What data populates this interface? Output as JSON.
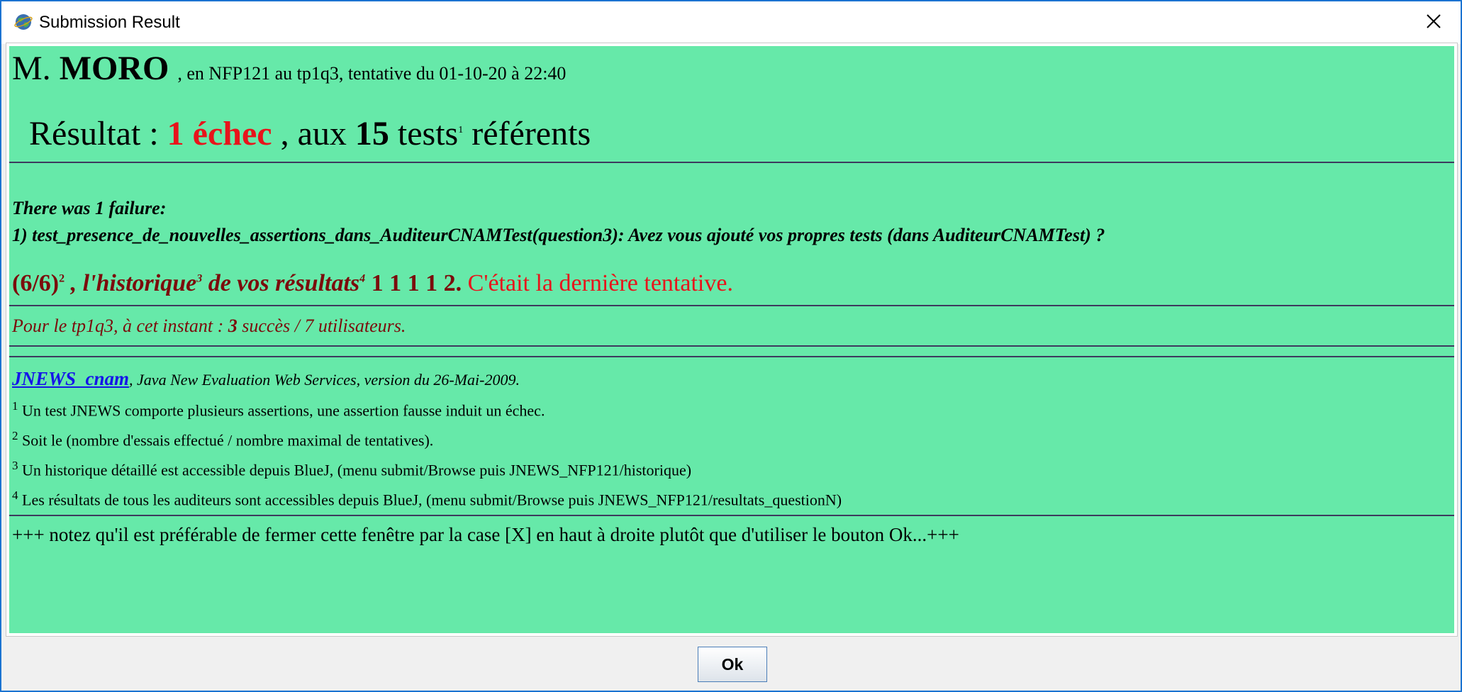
{
  "window": {
    "title": "Submission Result",
    "icon": "globe-icon",
    "close_icon": "close-icon",
    "ok_label": "Ok"
  },
  "report": {
    "honorific": "M.",
    "name": "MORO",
    "meta": ", en NFP121 au tp1q3, tentative du 01-10-20 à 22:40",
    "result_label": "Résultat :",
    "failures_count": "1 échec",
    "tests_sep": ", aux",
    "tests_count": "15",
    "tests_word": "tests",
    "tests_note_ref": "1",
    "tests_suffix": "référents",
    "failure_header": "There was 1 failure:",
    "failure_detail": "1) test_presence_de_nouvelles_assertions_dans_AuditeurCNAMTest(question3): Avez vous ajouté vos propres tests (dans AuditeurCNAMTest) ?",
    "attempts": "(6/6)",
    "attempts_note_ref": "2",
    "history_word": ", l'historique",
    "history_note_ref": "3",
    "history_tail": "de vos résultats",
    "results_note_ref": "4",
    "history_values": "1 1 1 1 2.",
    "last_attempt": "C'était la dernière tentative.",
    "stats_prefix": "Pour le tp1q3, à cet instant :",
    "stats_success": "3",
    "stats_suffix": "succès / 7 utilisateurs.",
    "jnews_link": "JNEWS_cnam",
    "jnews_desc": ", Java New Evaluation Web Services, version du 26-Mai-2009.",
    "notes": [
      {
        "ref": "1",
        "text": "Un test JNEWS comporte plusieurs assertions, une assertion fausse induit un échec."
      },
      {
        "ref": "2",
        "text": "Soit le (nombre d'essais effectué / nombre maximal de tentatives)."
      },
      {
        "ref": "3",
        "text": "Un historique détaillé est accessible depuis BlueJ, (menu submit/Browse puis JNEWS_NFP121/historique)"
      },
      {
        "ref": "4",
        "text": "Les résultats de tous les auditeurs sont accessibles depuis BlueJ, (menu submit/Browse puis JNEWS_NFP121/resultats_questionN)"
      }
    ],
    "tip": "+++ notez qu'il est préférable de fermer cette fenêtre par la case [X] en haut à droite plutôt que d'utiliser le bouton Ok...+++"
  },
  "colors": {
    "background": "#66e9a9",
    "failure_red": "#e8141b",
    "maroon": "#7b0c0c",
    "link_blue": "#1515e8"
  }
}
